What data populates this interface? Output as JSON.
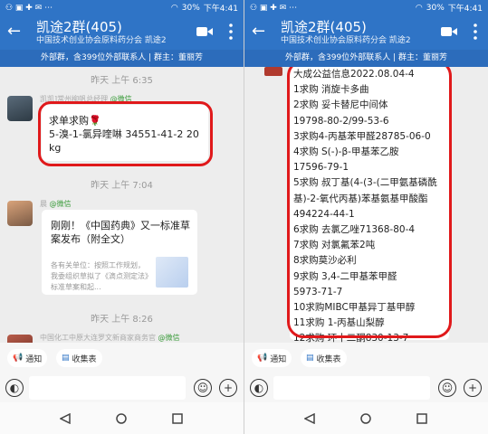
{
  "left": {
    "status": {
      "carrier": "⚇ ▣ ✚ ✉ ⋯",
      "battery": "30%",
      "time": "下午4:41"
    },
    "header": {
      "title": "凯途2群(405)",
      "subtitle": "中国技术创业协会原料药分会 凯途2"
    },
    "notice": "外部群，含399位外部联系人 | 群主：董丽芳",
    "messages": {
      "ts1": "昨天 上午 6:35",
      "sender1": "凯凯]常州柳帆总经理",
      "sender1_tag": "@微信",
      "bubble1_line1": "求单求购🌹",
      "bubble1_line2": "5-溴-1-氯异喹啉  34551-41-2    20 kg",
      "ts2": "昨天 上午 7:04",
      "sender2": "晨",
      "sender2_tag": "@微信",
      "card_title": "刚刚！《中国药典》又一标准草案发布（附全文）",
      "card_desc": "各有关单位：按照工作规划，我委组织草拟了《滴点测定法》标准草案和起...",
      "ts3": "昨天 上午 8:26",
      "sender3": "中国化工中原大连罗文新商家商务官",
      "sender3_tag": "@微信"
    },
    "quickbar": {
      "notify": "通知",
      "fav": "收集表"
    }
  },
  "right": {
    "status": {
      "carrier": "⚇ ▣ ✚ ✉ ⋯",
      "battery": "30%",
      "time": "下午4:41"
    },
    "header": {
      "title": "凯途2群(405)",
      "subtitle": "中国技术创业协会原料药分会 凯途2"
    },
    "notice": "外部群，含399位外部联系人 | 群主：董丽芳",
    "list": [
      "大成公益信息2022.08.04-4",
      "1求购 消旋卡多曲",
      "2求购 妥卡替尼中间体",
      "19798-80-2/99-53-6",
      "3求购4-丙基苯甲醛28785-06-0",
      "4求购 S(-)-β-甲基苯乙胺",
      "17596-79-1",
      "5求购 叔丁基(4-(3-(二甲氨基磷酰",
      "基)-2-氧代丙基)苯基氨基甲酸酯",
      "494224-44-1",
      "6求购 去氯乙唑71368-80-4",
      "7求购 对氯氟苯2吨",
      "8求购莫沙必利",
      "9求购 3,4-二甲基苯甲醛",
      "5973-71-7",
      "10求购MIBC甲基异丁基甲醇",
      "11求购 1-丙基山梨醇",
      "12求购 环十二酮830-13-7",
      "13求购 对甲基苯甲醛 104-87-0"
    ],
    "quickbar": {
      "notify": "通知",
      "fav": "收集表"
    }
  },
  "colors": {
    "header": "#2f74c6",
    "highlight": "#e0191b",
    "wechat_tag": "#3a9b3a"
  }
}
